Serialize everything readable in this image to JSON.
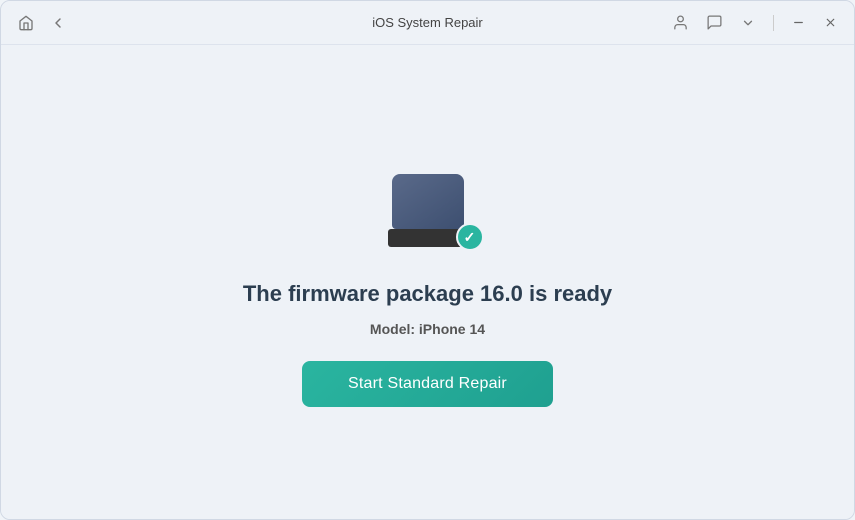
{
  "window": {
    "title": "iOS System Repair"
  },
  "titlebar": {
    "home_icon": "⌂",
    "back_icon": "←",
    "user_icon": "person",
    "chat_icon": "chat",
    "chevron_icon": "chevron",
    "minimize_icon": "—",
    "close_icon": "✕"
  },
  "main": {
    "firmware_ready_text": "The firmware package 16.0 is ready",
    "model_label": "Model:",
    "model_value": "iPhone 14",
    "start_button_label": "Start Standard Repair",
    "check_symbol": "✓",
    "apple_symbol": ""
  }
}
